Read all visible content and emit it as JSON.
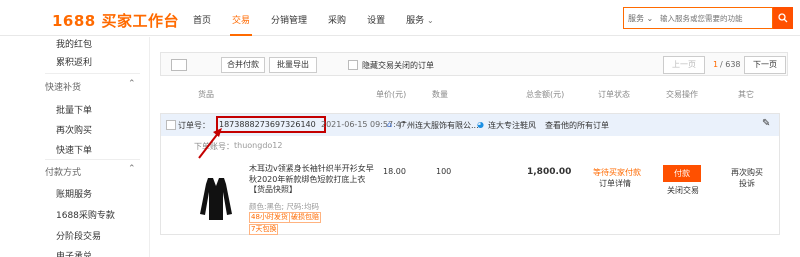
{
  "header": {
    "logo": "1688 买家工作台",
    "nav": [
      {
        "label": "首页"
      },
      {
        "label": "交易"
      },
      {
        "label": "分销管理"
      },
      {
        "label": "采购"
      },
      {
        "label": "设置"
      },
      {
        "label": "服务"
      }
    ],
    "search": {
      "scope": "服务 ⌄",
      "placeholder": "输入服务或您需要的功能"
    }
  },
  "sidebar": {
    "items_top": [
      {
        "label": "我的红包"
      },
      {
        "label": "累积返利"
      }
    ],
    "section1": "快速补货",
    "section1_items": [
      {
        "label": "批量下单"
      },
      {
        "label": "再次购买"
      },
      {
        "label": "快速下单"
      }
    ],
    "section2": "付款方式",
    "section2_items": [
      {
        "label": "账期服务"
      },
      {
        "label": "1688采购专款"
      },
      {
        "label": "分阶段交易"
      },
      {
        "label": "电子承兑"
      }
    ]
  },
  "toolbar": {
    "merge_pay": "合并付款",
    "batch_export": "批量导出",
    "hide_closed": "隐藏交易关闭的订单",
    "prev": "上一页",
    "page_current": "1",
    "page_total": "/ 638",
    "next": "下一页"
  },
  "columns": {
    "product": "货品",
    "unit_price": "单价(元)",
    "quantity": "数量",
    "total": "总金额(元)",
    "status": "订单状态",
    "action": "交易操作",
    "other": "其它"
  },
  "order": {
    "order_label": "订单号：",
    "order_no": "1873888273697326140",
    "time": "2021-06-15 09:57:47",
    "shop": "广州连大服饰有限公...",
    "contact": "连大专注鞋风",
    "view_all": "查看他的所有订单",
    "buyer_label": "下单账号：",
    "buyer": "thuongdo12",
    "product_title": "木耳边v领紧身长袖针织半开衫女早秋2020年新款绑色短款打底上衣【货品快照】",
    "attrs": "颜色:黑色; 尺码:均码",
    "tags": [
      "48小时发货",
      "破损包赔",
      "7天包换"
    ],
    "unit_price": "18.00",
    "quantity": "100",
    "total": "1,800.00",
    "status_line1": "等待买家付款",
    "status_line2": "订单详情",
    "pay_button": "付款",
    "close_trade": "关闭交易",
    "rebuy": "再次购买",
    "complain": "投诉"
  }
}
